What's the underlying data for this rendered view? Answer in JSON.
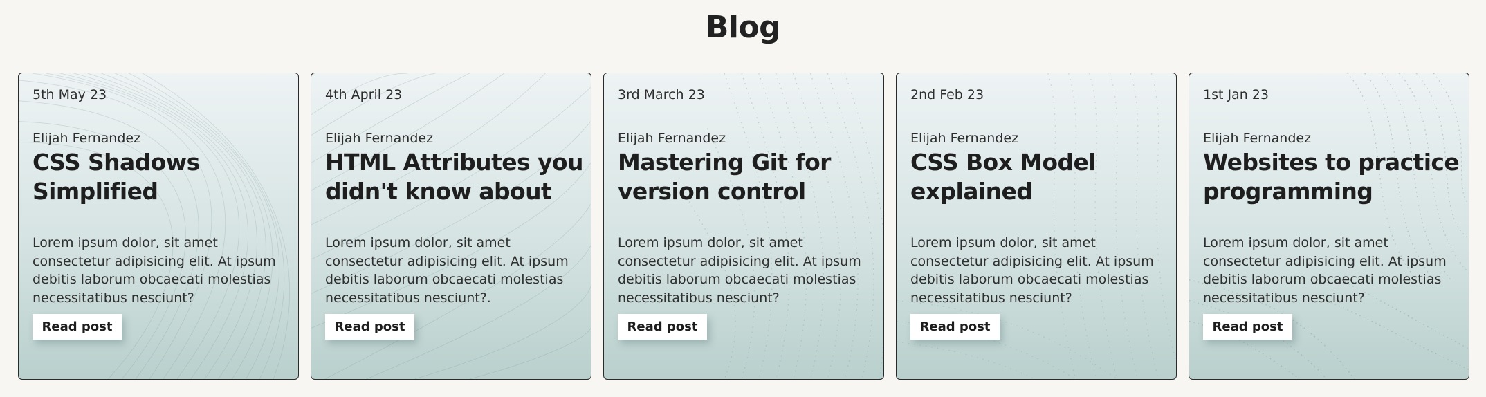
{
  "header": {
    "title": "Blog"
  },
  "posts": [
    {
      "date": "5th May 23",
      "author": "Elijah Fernandez",
      "title": "CSS Shadows Simplified",
      "excerpt": "Lorem ipsum dolor, sit amet consectetur adipisicing elit. At ipsum debitis laborum obcaecati molestias necessitatibus nesciunt?",
      "button_label": "Read post"
    },
    {
      "date": "4th April 23",
      "author": "Elijah Fernandez",
      "title": "HTML Attributes you didn't know about",
      "excerpt": "Lorem ipsum dolor, sit amet consectetur adipisicing elit. At ipsum debitis laborum obcaecati molestias necessitatibus nesciunt?.",
      "button_label": "Read post"
    },
    {
      "date": "3rd March 23",
      "author": "Elijah Fernandez",
      "title": "Mastering Git for version control",
      "excerpt": "Lorem ipsum dolor, sit amet consectetur adipisicing elit. At ipsum debitis laborum obcaecati molestias necessitatibus nesciunt?",
      "button_label": "Read post"
    },
    {
      "date": "2nd Feb 23",
      "author": "Elijah Fernandez",
      "title": "CSS Box Model explained",
      "excerpt": "Lorem ipsum dolor, sit amet consectetur adipisicing elit. At ipsum debitis laborum obcaecati molestias necessitatibus nesciunt?",
      "button_label": "Read post"
    },
    {
      "date": "1st Jan 23",
      "author": "Elijah Fernandez",
      "title": "Websites to practice programming",
      "excerpt": "Lorem ipsum dolor, sit amet consectetur adipisicing elit. At ipsum debitis laborum obcaecati molestias necessitatibus nesciunt?",
      "button_label": "Read post"
    }
  ],
  "colors": {
    "page_background": "#f7f6f2",
    "card_gradient_top": "#eef3f4",
    "card_gradient_bottom": "#b9d0cd",
    "text": "#1e1e1e",
    "button_background": "#ffffff"
  }
}
